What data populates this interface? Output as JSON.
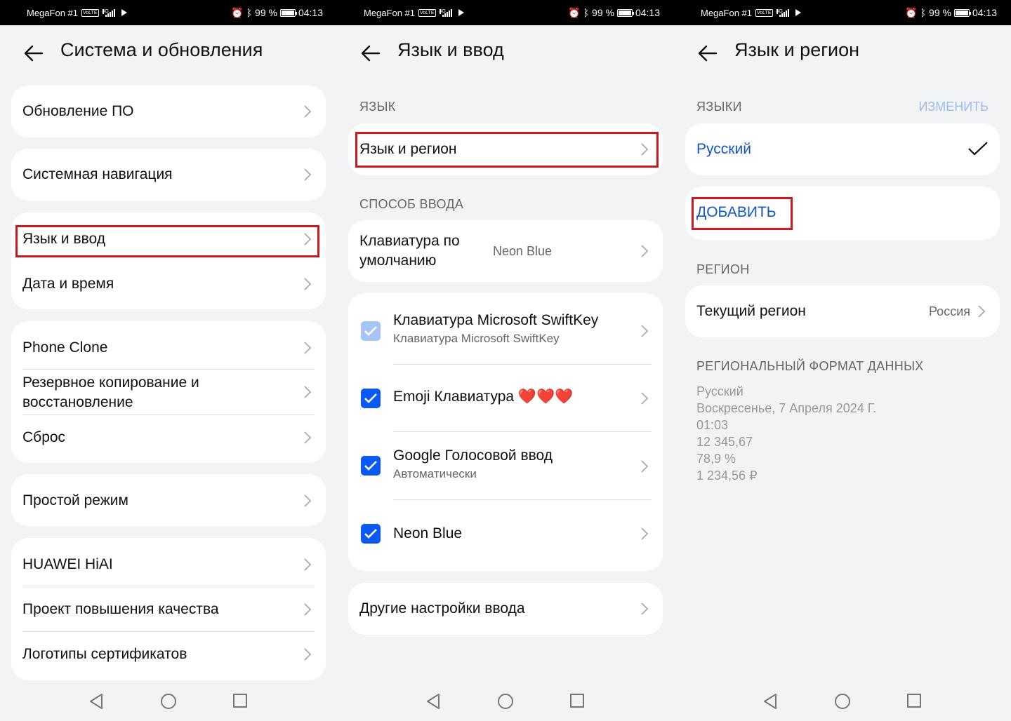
{
  "status_bar": {
    "carrier": "MegaFon #1",
    "volte": "VoLTE",
    "net": "4G",
    "battery": "99 %",
    "time": "04:13"
  },
  "screen1": {
    "title": "Система и обновления",
    "items": [
      {
        "label": "Обновление ПО"
      },
      {
        "label": "Системная навигация"
      },
      {
        "label": "Язык и ввод"
      },
      {
        "label": "Дата и время"
      },
      {
        "label": "Phone Clone"
      },
      {
        "label": "Резервное копирование и восстановление"
      },
      {
        "label": "Сброс"
      },
      {
        "label": "Простой режим"
      },
      {
        "label": "HUAWEI HiAI"
      },
      {
        "label": "Проект повышения качества"
      },
      {
        "label": "Логотипы сертификатов"
      }
    ]
  },
  "screen2": {
    "title": "Язык и ввод",
    "section_language": "ЯЗЫК",
    "language_region": "Язык и регион",
    "section_input": "СПОСОБ ВВОДА",
    "default_keyboard": {
      "label": "Клавиатура по умолчанию",
      "value": "Neon Blue"
    },
    "keyboards": [
      {
        "title": "Клавиатура Microsoft SwiftKey",
        "subtitle": "Клавиатура Microsoft SwiftKey",
        "checked": true,
        "disabled": true
      },
      {
        "title": "Emoji Клавиатура ❤️❤️❤️",
        "subtitle": "",
        "checked": true,
        "disabled": false
      },
      {
        "title": "Google Голосовой ввод",
        "subtitle": "Автоматически",
        "checked": true,
        "disabled": false
      },
      {
        "title": "Neon Blue",
        "subtitle": "",
        "checked": true,
        "disabled": false
      }
    ],
    "other_settings": "Другие настройки ввода"
  },
  "screen3": {
    "title": "Язык и регион",
    "section_languages": "ЯЗЫКИ",
    "edit": "ИЗМЕНИТЬ",
    "language": "Русский",
    "add": "ДОБАВИТЬ",
    "section_region": "РЕГИОН",
    "current_region": {
      "label": "Текущий регион",
      "value": "Россия"
    },
    "section_format": "РЕГИОНАЛЬНЫЙ ФОРМАТ ДАННЫХ",
    "format_lines": [
      "Русский",
      "Воскресенье, 7 Апреля 2024 Г.",
      "01:03",
      "12 345,67",
      "78,9 %",
      "1 234,56 ₽"
    ]
  },
  "colors": {
    "accent": "#0a59f7",
    "highlight": "#d2161d",
    "link": "#1156c4",
    "background": "#f1f3f5"
  },
  "icons": [
    "back-arrow-icon",
    "chevron-right-icon",
    "checkmark-icon",
    "checkbox-icon",
    "nav-back-icon",
    "nav-home-icon",
    "nav-recents-icon",
    "alarm-icon",
    "bluetooth-icon",
    "battery-icon",
    "play-icon",
    "signal-icon"
  ]
}
